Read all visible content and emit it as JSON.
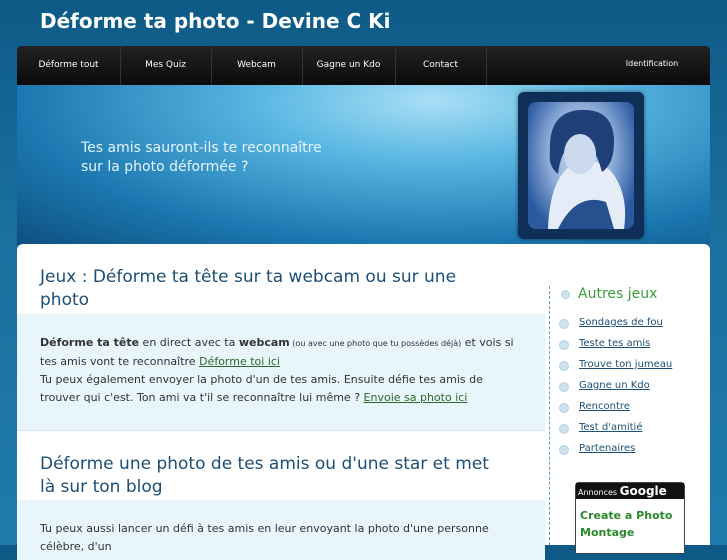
{
  "site": {
    "title": "Déforme ta photo - Devine C Ki"
  },
  "nav": {
    "items": [
      "Déforme tout",
      "Mes Quiz",
      "Webcam",
      "Gagne un Kdo",
      "Contact"
    ],
    "login": "Identification"
  },
  "banner": {
    "tagline": "Tes amis sauront-ils te reconnaître sur la photo déformée ?"
  },
  "section1": {
    "heading": "Jeux : Déforme ta tête sur ta webcam ou sur une photo",
    "strong1": "Déforme ta tête",
    "t1": " en direct avec ta ",
    "strong2": "webcam",
    "small": " (ou avec une photo que tu possèdes déjà)",
    "t2": " et vois si tes amis vont te reconnaître ",
    "link1": "Déforme toi ici",
    "t3": "Tu peux également envoyer la photo d'un de tes amis. Ensuite défie tes amis de trouver qui c'est. Ton ami va t'il se reconnaître lui même ? ",
    "link2": "Envoie sa photo ici"
  },
  "section2": {
    "heading": "Déforme une photo de tes amis ou d'une star et met là sur ton blog",
    "text": "Tu peux aussi lancer un défi à tes amis en leur envoyant la photo d'une personne célèbre, d'un"
  },
  "sidebar": {
    "title": "Autres jeux",
    "links": [
      "Sondages de fou",
      "Teste tes amis",
      "Trouve ton jumeau",
      "Gagne un Kdo",
      "Rencontre",
      "Test d'amitié",
      "Partenaires"
    ]
  },
  "ad": {
    "label": "Annonces",
    "brand": "Google",
    "link": "Create a Photo Montage"
  },
  "colors": {
    "accent_green": "#3c9a3c",
    "heading_blue": "#1c4f73"
  }
}
